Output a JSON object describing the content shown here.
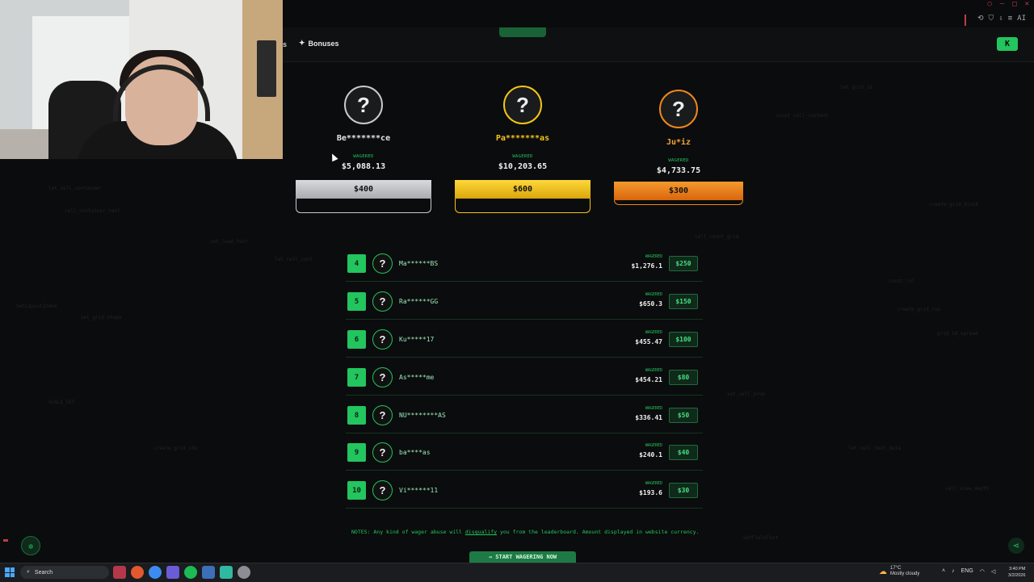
{
  "browser": {
    "toolbar_ai": "AI"
  },
  "nav": {
    "partial_label": "s",
    "bonuses_label": "Bonuses",
    "bonuses_icon": "sparkle-icon",
    "kick_icon": "kick-logo-icon"
  },
  "top3": [
    {
      "name": "Be*******ce",
      "wagered_label": "WAGERED",
      "wagered": "$5,088.13",
      "prize": "$400",
      "color": "#c7c9cc",
      "name_color": "#e6e6e6"
    },
    {
      "name": "Pa*******as",
      "wagered_label": "WAGERED",
      "wagered": "$10,203.65",
      "prize": "$600",
      "color": "#f5c518",
      "name_color": "#f5c518"
    },
    {
      "name": "Ju*iz",
      "wagered_label": "WAGERED",
      "wagered": "$4,733.75",
      "prize": "$300",
      "color": "#f0861c",
      "name_color": "#f0a33a"
    }
  ],
  "rows": [
    {
      "rank": "4",
      "name": "Ma******BS",
      "wagered_label": "WAGERED",
      "wagered": "$1,276.1",
      "prize": "$250"
    },
    {
      "rank": "5",
      "name": "Ra******GG",
      "wagered_label": "WAGERED",
      "wagered": "$650.3",
      "prize": "$150"
    },
    {
      "rank": "6",
      "name": "Ku*****17",
      "wagered_label": "WAGERED",
      "wagered": "$455.47",
      "prize": "$100"
    },
    {
      "rank": "7",
      "name": "As*****me",
      "wagered_label": "WAGERED",
      "wagered": "$454.21",
      "prize": "$80"
    },
    {
      "rank": "8",
      "name": "NU********AS",
      "wagered_label": "WAGERED",
      "wagered": "$336.41",
      "prize": "$50"
    },
    {
      "rank": "9",
      "name": "ba****as",
      "wagered_label": "WAGERED",
      "wagered": "$240.1",
      "prize": "$40"
    },
    {
      "rank": "10",
      "name": "Vi******11",
      "wagered_label": "WAGERED",
      "wagered": "$193.6",
      "prize": "$30"
    }
  ],
  "notes": {
    "prefix": "NOTES: Any kind of wager abuse will ",
    "link": "disqualify",
    "suffix": " you from the leaderboard. Amount displayed in website currency."
  },
  "cta_label": "START WAGERING NOW",
  "taskbar": {
    "search_placeholder": "Search",
    "weather_temp": "17°C",
    "weather_desc": "Mostly cloudy",
    "lang": "ENG",
    "time": "3:40 PM",
    "date": "3/2/2026"
  },
  "colors": {
    "accent_green": "#22c55e",
    "background": "#0b0c0d"
  }
}
